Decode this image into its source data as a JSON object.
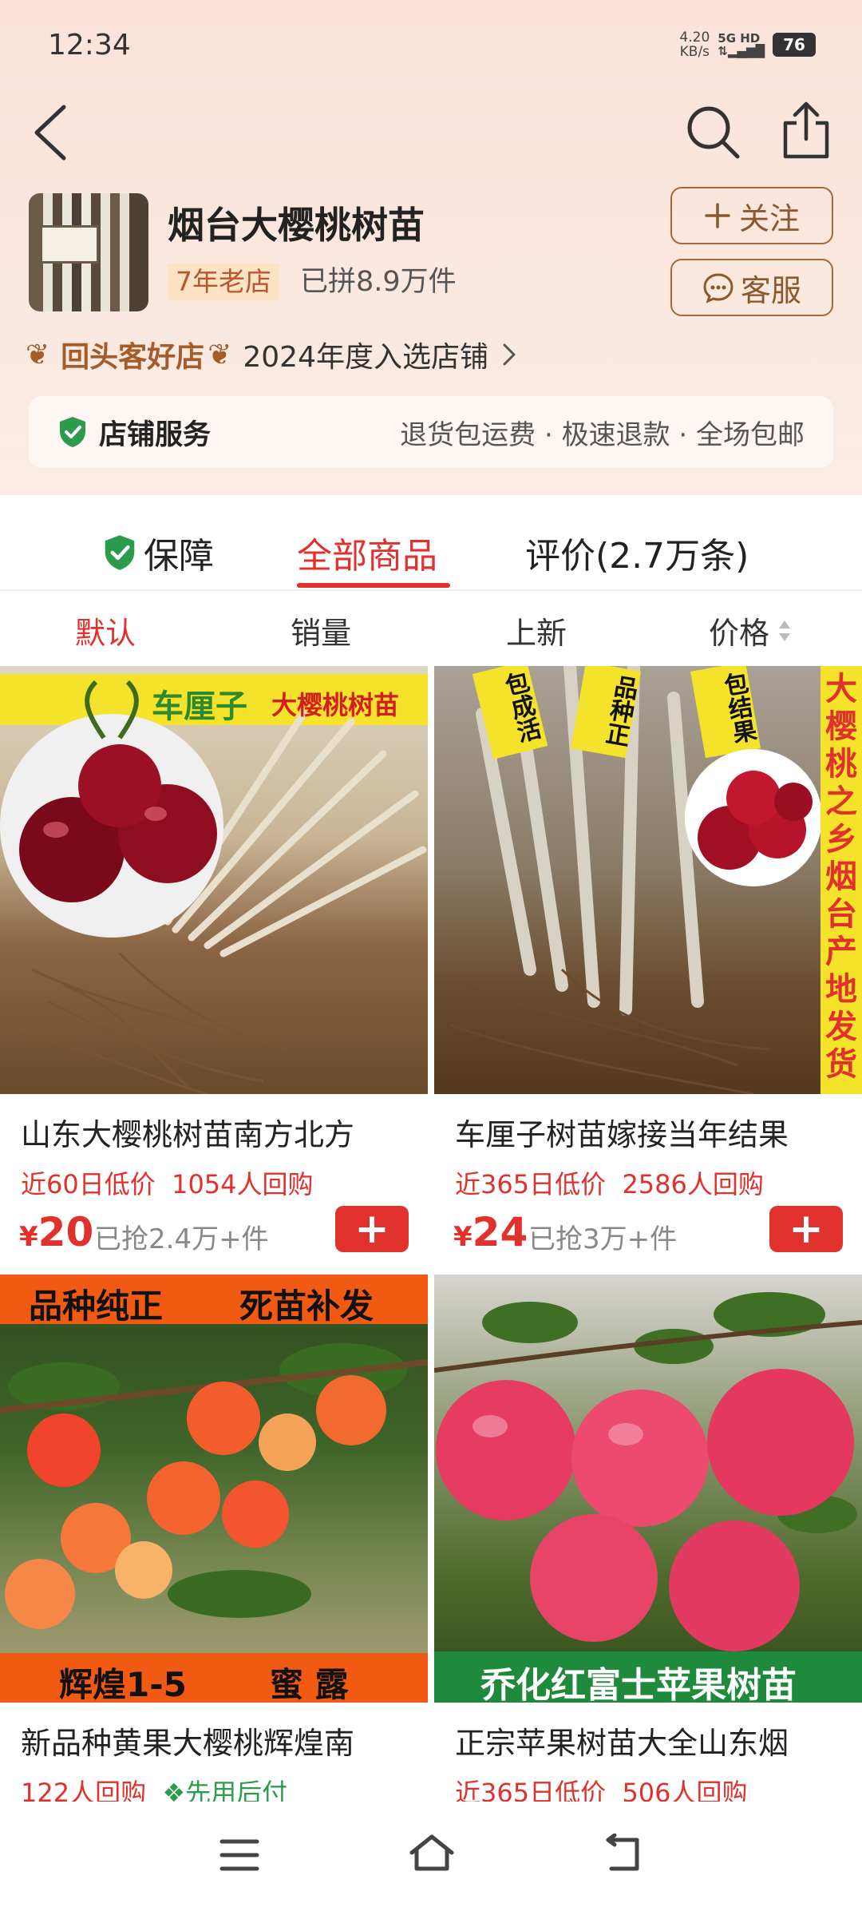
{
  "status": {
    "time": "12:34",
    "net_speed": "4.20",
    "net_unit": "KB/s",
    "network": "5G HD",
    "battery": "76"
  },
  "shop": {
    "name": "烟台大樱桃树苗",
    "years_tag": "7年老店",
    "sold": "已拼8.9万件",
    "follow_label": "关注",
    "service_label": "客服",
    "badge_name": "回头客好店",
    "badge_desc": "2024年度入选店铺",
    "service_title": "店铺服务",
    "service_items": "退货包运费 · 极速退款 · 全场包邮"
  },
  "tabs": [
    {
      "label": "保障"
    },
    {
      "label": "全部商品"
    },
    {
      "label": "评价(2.7万条)"
    }
  ],
  "sort": [
    {
      "label": "默认"
    },
    {
      "label": "销量"
    },
    {
      "label": "上新"
    },
    {
      "label": "价格"
    }
  ],
  "products": [
    {
      "image_banner": "车厘子",
      "image_banner2": "大樱桃树苗",
      "title": "山东大樱桃树苗南方北方",
      "meta1": "近60日低价",
      "meta2": "1054人回购",
      "price_symbol": "¥",
      "price": "20",
      "sold": "已抢2.4万+件"
    },
    {
      "image_tags": [
        "包成活",
        "品种正",
        "包结果"
      ],
      "image_side": "大樱桃之乡烟台产地发货",
      "title": "车厘子树苗嫁接当年结果",
      "meta1": "近365日低价",
      "meta2": "2586人回购",
      "price_symbol": "¥",
      "price": "24",
      "sold": "已抢3万+件"
    },
    {
      "image_top_left": "品种纯正",
      "image_top_right": "死苗补发",
      "image_bottom_left": "辉煌1-5",
      "image_bottom_right": "蜜 露",
      "title": "新品种黄果大樱桃辉煌南",
      "meta1": "122人回购",
      "meta2": "先用后付"
    },
    {
      "image_bottom": "乔化红富士苹果树苗",
      "title": "正宗苹果树苗大全山东烟",
      "meta1": "近365日低价",
      "meta2": "506人回购"
    }
  ],
  "colors": {
    "accent": "#e0312d",
    "gold": "#a06a3c",
    "green": "#2c9c4c"
  }
}
